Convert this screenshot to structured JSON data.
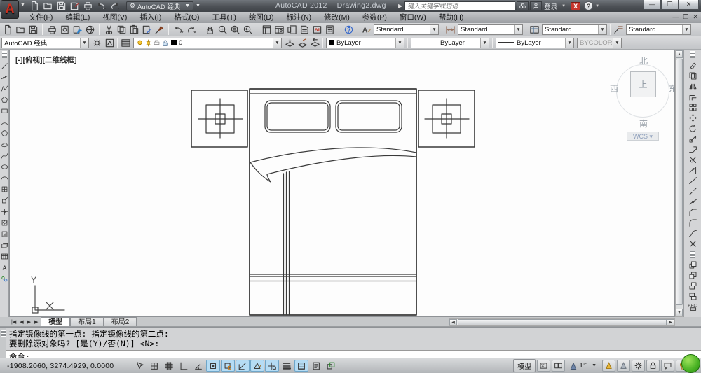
{
  "title_bar": {
    "logo_letter": "A",
    "workspace_label": "AutoCAD 经典",
    "app_name": "AutoCAD 2012",
    "doc_name": "Drawing2.dwg",
    "search_placeholder": "键入关键字或短语",
    "signin_label": "登录",
    "exchange_label": "X",
    "help_label": "?",
    "window_controls": {
      "minimize": "—",
      "restore": "❐",
      "close": "✕"
    },
    "quick_access_icons": [
      "qnew",
      "open",
      "save",
      "saveas",
      "plot",
      "undo",
      "redo"
    ]
  },
  "menu_bar": {
    "items": [
      "文件(F)",
      "编辑(E)",
      "视图(V)",
      "插入(I)",
      "格式(O)",
      "工具(T)",
      "绘图(D)",
      "标注(N)",
      "修改(M)",
      "参数(P)",
      "窗口(W)",
      "帮助(H)"
    ],
    "doc_controls": {
      "minimize": "—",
      "restore": "❐",
      "close": "✕"
    }
  },
  "standard_toolbar": {
    "groups": [
      [
        "qnew",
        "open",
        "save"
      ],
      [
        "plot",
        "plot-preview",
        "publish",
        "3d-dwf"
      ],
      [
        "cut",
        "copy",
        "paste",
        "paste-special",
        "match-properties"
      ],
      [
        "undo",
        "redo"
      ],
      [
        "pan",
        "zoom-realtime",
        "zoom-window",
        "zoom-previous"
      ],
      [
        "properties",
        "designcenter",
        "tool-palettes",
        "sheetset-manager",
        "markup-set-manager",
        "quickcalc"
      ],
      [
        "help"
      ]
    ]
  },
  "style_toolbar": {
    "text_style": "Standard",
    "dim_style": "Standard",
    "table_style": "Standard",
    "mleader_style": "Standard"
  },
  "workspace_toolbar": {
    "value": "AutoCAD 经典",
    "icons": [
      "workspace-settings",
      "my-workspace"
    ]
  },
  "layer_toolbar": {
    "layer_value": "0",
    "left_icons": [
      "layer-properties"
    ],
    "right_icons": [
      "make-object-layer-current",
      "layer-match",
      "layer-previous"
    ]
  },
  "properties_toolbar": {
    "color": "ByLayer",
    "linetype": "ByLayer",
    "lineweight": "ByLayer",
    "plot_style": "BYCOLOR"
  },
  "draw_toolbar": {
    "icons": [
      "line",
      "construction-line",
      "polyline",
      "polygon",
      "rectangle",
      "arc",
      "circle",
      "revision-cloud",
      "spline",
      "ellipse",
      "ellipse-arc",
      "insert-block",
      "make-block",
      "point",
      "hatch",
      "gradient",
      "region",
      "table",
      "multiline-text",
      "add-selected"
    ]
  },
  "modify_toolbar": {
    "icons": [
      "erase",
      "copy",
      "mirror",
      "offset",
      "array",
      "move",
      "rotate",
      "scale",
      "stretch",
      "trim",
      "extend",
      "break-at-point",
      "break",
      "join",
      "chamfer",
      "fillet",
      "blend-curves",
      "explode"
    ]
  },
  "draworder_toolbar": {
    "icons": [
      "bring-to-front",
      "send-to-back",
      "bring-above-objects",
      "send-under-objects",
      "text-to-front"
    ]
  },
  "canvas": {
    "viewport_label": "[-][俯视][二维线框]",
    "viewcube": {
      "north": "北",
      "south": "南",
      "west": "西",
      "east": "东",
      "top": "上",
      "wcs_label": "WCS ▾"
    },
    "ucs_icon": {
      "x_label": "X",
      "y_label": "Y"
    }
  },
  "layout_tabs": {
    "items": [
      "模型",
      "布局1",
      "布局2"
    ],
    "active_index": 0
  },
  "command_window": {
    "history_lines": [
      "指定镜像线的第一点: 指定镜像线的第二点:",
      "要删除源对象吗? [是(Y)/否(N)] <N>:"
    ],
    "prompt": "命令:"
  },
  "status_bar": {
    "coordinates": "-1908.2060, 3274.4929, 0.0000",
    "toggles": [
      {
        "name": "infer-constraints",
        "on": false
      },
      {
        "name": "snap-mode",
        "on": false
      },
      {
        "name": "grid-display",
        "on": false
      },
      {
        "name": "ortho-mode",
        "on": false
      },
      {
        "name": "polar-tracking",
        "on": false
      },
      {
        "name": "object-snap",
        "on": true
      },
      {
        "name": "3d-object-snap",
        "on": true
      },
      {
        "name": "object-snap-tracking",
        "on": true
      },
      {
        "name": "dynamic-ucs",
        "on": true
      },
      {
        "name": "dynamic-input",
        "on": true
      },
      {
        "name": "lineweight-display",
        "on": false
      },
      {
        "name": "transparency",
        "on": true
      },
      {
        "name": "quick-properties",
        "on": false
      },
      {
        "name": "selection-cycling",
        "on": false
      }
    ],
    "model_button": "模型",
    "quickview_icons": [
      "quick-view-layouts",
      "quick-view-drawings"
    ],
    "annotation_scale": "1:1",
    "annotation_icons": [
      "annotation-visibility",
      "annotation-autoscale"
    ],
    "right_icons": [
      "workspace-switching",
      "lock-ui",
      "hardware-acceleration",
      "isolate-objects"
    ]
  }
}
